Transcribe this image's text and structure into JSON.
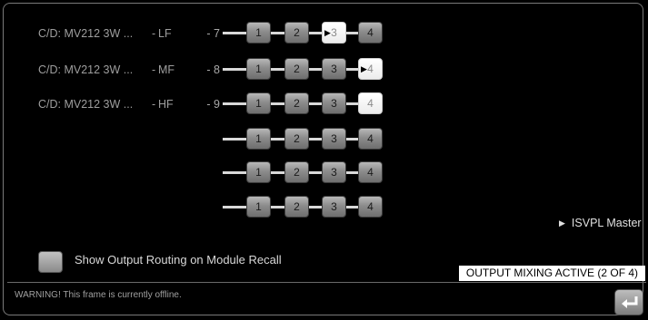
{
  "rows": [
    {
      "label": "C/D: MV212 3W ...",
      "dash": "-",
      "band": "LF",
      "num": "- 7",
      "buttons": [
        "1",
        "2",
        "3",
        "4"
      ],
      "selected": 2
    },
    {
      "label": "C/D: MV212 3W ...",
      "dash": "-",
      "band": "MF",
      "num": "- 8",
      "buttons": [
        "1",
        "2",
        "3",
        "4"
      ],
      "selected": 3
    },
    {
      "label": "C/D: MV212 3W ...",
      "dash": "-",
      "band": "HF",
      "num": "- 9",
      "buttons": [
        "1",
        "2",
        "3",
        "4"
      ],
      "selected": 3
    },
    {
      "label": "",
      "dash": "",
      "band": "",
      "num": "",
      "buttons": [
        "1",
        "2",
        "3",
        "4"
      ],
      "selected": null
    },
    {
      "label": "",
      "dash": "",
      "band": "",
      "num": "",
      "buttons": [
        "1",
        "2",
        "3",
        "4"
      ],
      "selected": null
    },
    {
      "label": "",
      "dash": "",
      "band": "",
      "num": "",
      "buttons": [
        "1",
        "2",
        "3",
        "4"
      ],
      "selected": null
    }
  ],
  "master": {
    "label": "ISVPL Master",
    "icon": "play-triangle-icon"
  },
  "recall": {
    "label": "Show Output Routing on Module Recall",
    "checked": false
  },
  "status": {
    "text": "OUTPUT MIXING ACTIVE (2 OF 4)"
  },
  "footer": {
    "warning": "WARNING! This frame is currently offline.",
    "enter_icon": "enter-return-icon"
  },
  "colors": {
    "background": "#000000",
    "button": "#8c8c8c",
    "selected_button": "#ffffff",
    "line": "#d9d9d9"
  }
}
